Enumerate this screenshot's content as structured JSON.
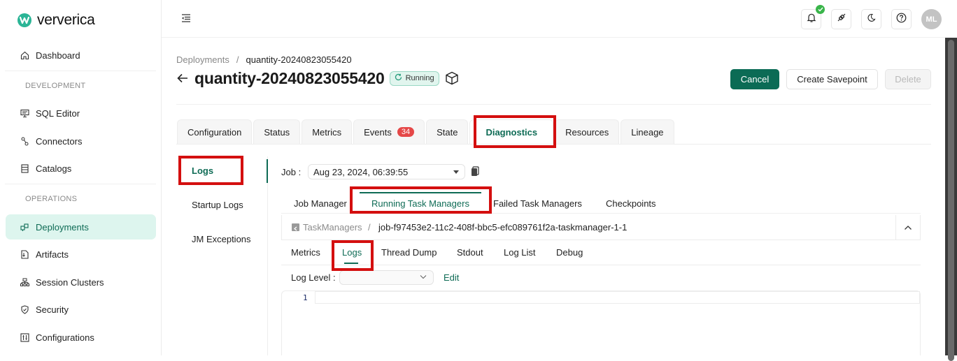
{
  "brand": {
    "name": "ververica",
    "accent": "#0e6b55",
    "logo_color": "#2bb596"
  },
  "sidebar": {
    "items": [
      {
        "label": "Dashboard",
        "icon": "home-icon"
      },
      {
        "label": "SQL Editor",
        "icon": "sql-monitor-icon"
      },
      {
        "label": "Connectors",
        "icon": "connectors-icon"
      },
      {
        "label": "Catalogs",
        "icon": "catalog-icon"
      },
      {
        "label": "Deployments",
        "icon": "deployments-icon",
        "active": true
      },
      {
        "label": "Artifacts",
        "icon": "artifact-file-icon"
      },
      {
        "label": "Session Clusters",
        "icon": "cluster-icon"
      },
      {
        "label": "Security",
        "icon": "shield-icon"
      },
      {
        "label": "Configurations",
        "icon": "sliders-icon"
      }
    ],
    "sections": {
      "development": "DEVELOPMENT",
      "operations": "OPERATIONS"
    }
  },
  "topbar": {
    "menu_icon": "menu-collapse-icon",
    "icons": [
      "bell-icon",
      "plug-icon",
      "moon-icon",
      "help-icon"
    ],
    "notification_status": "check",
    "avatar_initials": "ML"
  },
  "header": {
    "breadcrumb": {
      "parent": "Deployments",
      "separator": "/",
      "current": "quantity-20240823055420"
    },
    "title": "quantity-20240823055420",
    "status": "Running",
    "buttons": {
      "cancel": "Cancel",
      "savepoint": "Create Savepoint",
      "delete": "Delete"
    }
  },
  "tabs": [
    {
      "label": "Configuration"
    },
    {
      "label": "Status"
    },
    {
      "label": "Metrics"
    },
    {
      "label": "Events",
      "count": "34"
    },
    {
      "label": "State"
    },
    {
      "label": "Diagnostics",
      "active": true
    },
    {
      "label": "Resources"
    },
    {
      "label": "Lineage"
    }
  ],
  "diagnostics": {
    "menu": [
      {
        "label": "Logs",
        "active": true
      },
      {
        "label": "Startup Logs"
      },
      {
        "label": "JM Exceptions"
      }
    ],
    "job_label": "Job :",
    "job_value": "Aug 23, 2024, 06:39:55",
    "sub_tabs": [
      {
        "label": "Job Manager"
      },
      {
        "label": "Running Task Managers",
        "active": true
      },
      {
        "label": "Failed Task Managers"
      },
      {
        "label": "Checkpoints"
      }
    ],
    "taskmanager": {
      "back_label": "TaskManagers",
      "separator": "/",
      "name": "job-f97453e2-11c2-408f-bbc5-efc089761f2a-taskmanager-1-1"
    },
    "inner_tabs": [
      {
        "label": "Metrics"
      },
      {
        "label": "Logs",
        "active": true
      },
      {
        "label": "Thread Dump"
      },
      {
        "label": "Stdout"
      },
      {
        "label": "Log List"
      },
      {
        "label": "Debug"
      }
    ],
    "log_level_label": "Log Level :",
    "log_level_value": "",
    "edit_label": "Edit",
    "editor": {
      "line_numbers": [
        "1"
      ],
      "content": ""
    }
  }
}
